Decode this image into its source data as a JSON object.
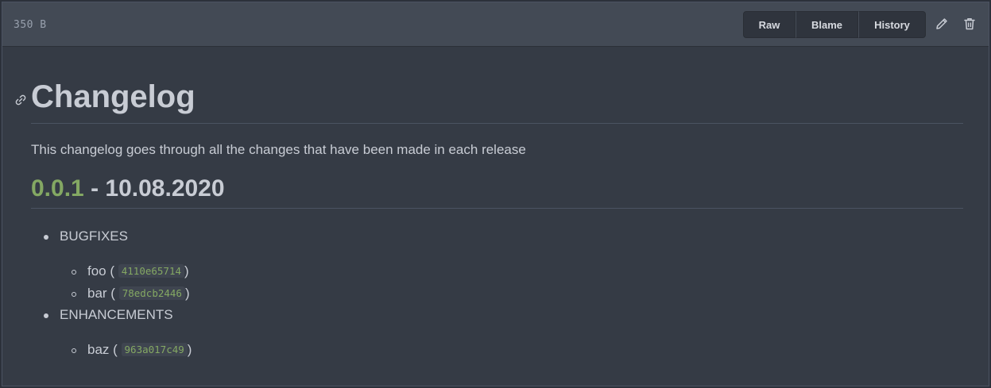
{
  "header": {
    "file_size": "350 B",
    "buttons": {
      "raw": "Raw",
      "blame": "Blame",
      "history": "History"
    },
    "icons": {
      "edit": "pencil-icon",
      "delete": "trash-icon"
    }
  },
  "readme": {
    "title": "Changelog",
    "anchor_icon": "link-icon",
    "intro": "This changelog goes through all the changes that have been made in each release",
    "release": {
      "version": "0.0.1",
      "separator": " - ",
      "date": "10.08.2020"
    },
    "sections": [
      {
        "label": "BUGFIXES",
        "items": [
          {
            "name": "foo",
            "commit": "4110e65714"
          },
          {
            "name": "bar",
            "commit": "78edcb2446"
          }
        ]
      },
      {
        "label": "ENHANCEMENTS",
        "items": [
          {
            "name": "baz",
            "commit": "963a017c49"
          }
        ]
      }
    ]
  },
  "colors": {
    "background": "#353b45",
    "header": "#434a55",
    "text": "#c8ccd4",
    "accent_green": "#84a863"
  }
}
